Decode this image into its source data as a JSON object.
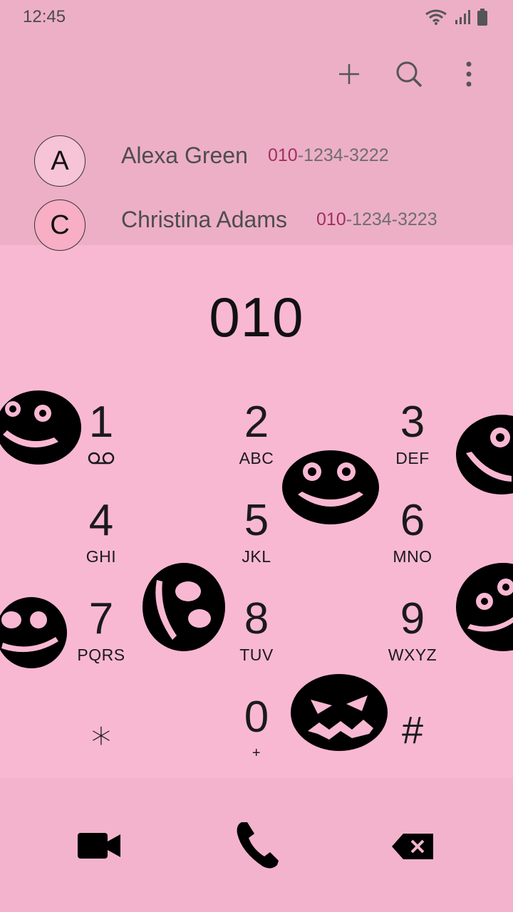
{
  "status_bar": {
    "time": "12:45"
  },
  "toolbar": {
    "add_icon": "plus-icon",
    "search_icon": "search-icon",
    "more_icon": "more-vertical-icon"
  },
  "contacts": [
    {
      "initial": "A",
      "name": "Alexa Green",
      "number_match": "010",
      "number_rest": "-1234-3222"
    },
    {
      "initial": "C",
      "name": "Christina Adams",
      "number_match": "010",
      "number_rest": "-1234-3223"
    }
  ],
  "dial": {
    "entered_number": "010"
  },
  "keypad": [
    {
      "digit": "1",
      "sub": ""
    },
    {
      "digit": "2",
      "sub": "ABC"
    },
    {
      "digit": "3",
      "sub": "DEF"
    },
    {
      "digit": "4",
      "sub": "GHI"
    },
    {
      "digit": "5",
      "sub": "JKL"
    },
    {
      "digit": "6",
      "sub": "MNO"
    },
    {
      "digit": "7",
      "sub": "PQRS"
    },
    {
      "digit": "8",
      "sub": "TUV"
    },
    {
      "digit": "9",
      "sub": "WXYZ"
    },
    {
      "digit": "⁎",
      "sub": ""
    },
    {
      "digit": "0",
      "sub": "+"
    },
    {
      "digit": "#",
      "sub": ""
    }
  ],
  "bottom_bar": {
    "video_icon": "video-call-icon",
    "call_icon": "phone-call-icon",
    "backspace_icon": "backspace-icon"
  },
  "colors": {
    "keypad_bg": "#f9b8d2",
    "header_bg": "#edafc6",
    "match_highlight": "#a0305c"
  }
}
